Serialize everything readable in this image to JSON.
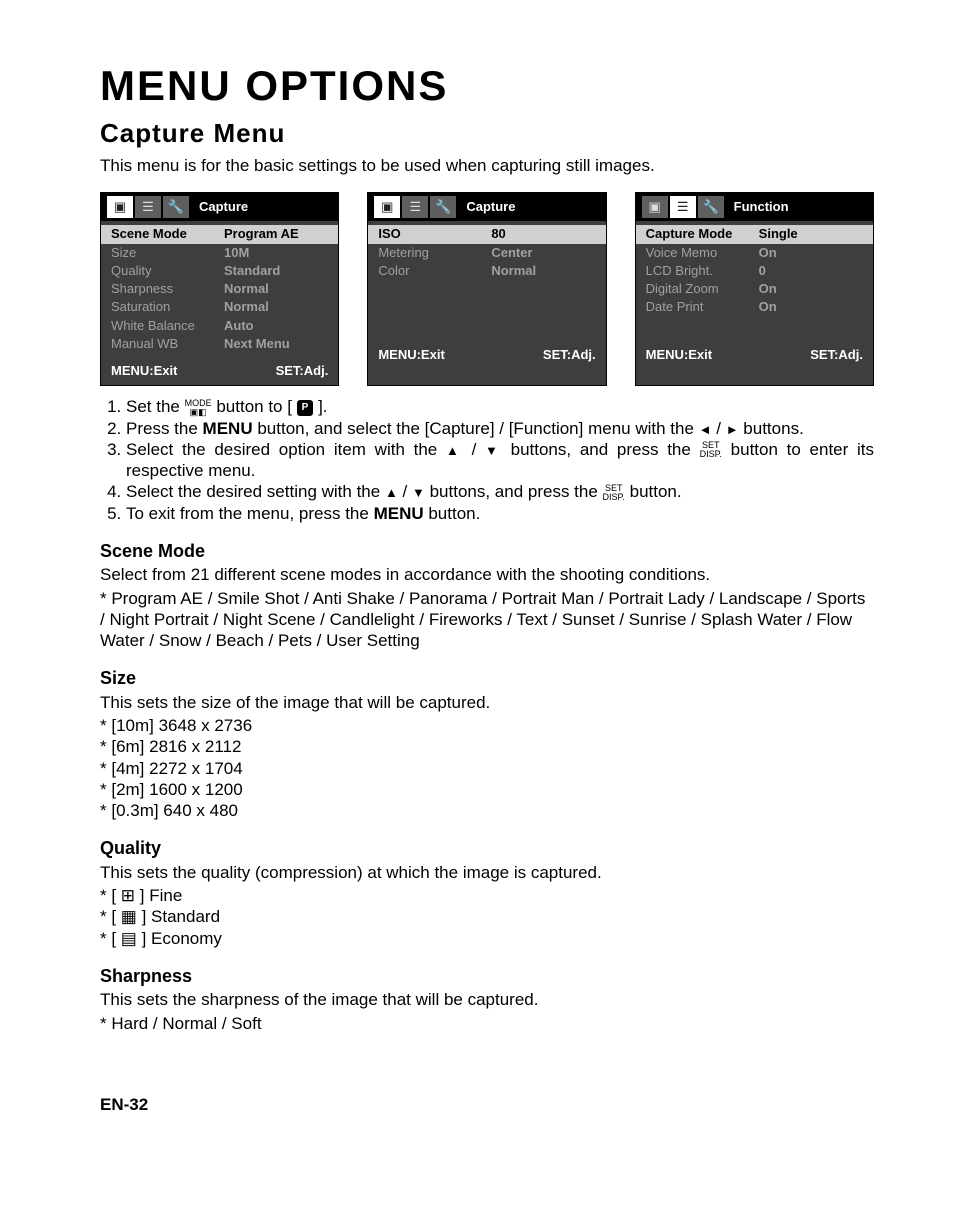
{
  "title": "MENU OPTIONS",
  "subtitle": "Capture Menu",
  "intro": "This menu is for the basic settings to be used when capturing still images.",
  "screens": [
    {
      "activeTab": 0,
      "title": "Capture",
      "rows": [
        {
          "label": "Scene Mode",
          "value": "Program AE",
          "selected": true
        },
        {
          "label": "Size",
          "value": "10M"
        },
        {
          "label": "Quality",
          "value": "Standard"
        },
        {
          "label": "Sharpness",
          "value": "Normal"
        },
        {
          "label": "Saturation",
          "value": "Normal"
        },
        {
          "label": "White Balance",
          "value": "Auto"
        },
        {
          "label": "Manual WB",
          "value": "Next Menu"
        }
      ],
      "footer": {
        "left": "MENU:Exit",
        "right": "SET:Adj."
      }
    },
    {
      "activeTab": 0,
      "title": "Capture",
      "rows": [
        {
          "label": "ISO",
          "value": "80",
          "selected": true
        },
        {
          "label": "Metering",
          "value": "Center"
        },
        {
          "label": "Color",
          "value": "Normal"
        }
      ],
      "footer": {
        "left": "MENU:Exit",
        "right": "SET:Adj."
      }
    },
    {
      "activeTab": 1,
      "title": "Function",
      "rows": [
        {
          "label": "Capture Mode",
          "value": "Single",
          "selected": true
        },
        {
          "label": "Voice Memo",
          "value": "On"
        },
        {
          "label": "LCD Bright.",
          "value": "0"
        },
        {
          "label": "Digital Zoom",
          "value": "On"
        },
        {
          "label": "Date Print",
          "value": "On"
        }
      ],
      "footer": {
        "left": "MENU:Exit",
        "right": "SET:Adj."
      }
    }
  ],
  "steps": [
    "Set the  MODE  button to [ P ].",
    "Press the MENU button, and select the [Capture] / [Function] menu with the ◄ / ► buttons.",
    "Select the desired option item with the ▲ / ▼ buttons, and press the SET/DISP. button to enter its respective menu.",
    "Select the desired setting with the ▲ / ▼ buttons, and press the SET/DISP. button.",
    "To exit from the menu, press the MENU button."
  ],
  "sections": [
    {
      "heading": "Scene Mode",
      "desc": "Select from 21 different scene modes in accordance with the shooting conditions.",
      "options": "* Program AE / Smile Shot / Anti Shake / Panorama / Portrait Man / Portrait Lady / Landscape / Sports / Night Portrait /  Night Scene / Candlelight / Fireworks / Text / Sunset / Sunrise / Splash Water / Flow Water / Snow / Beach / Pets / User Setting"
    },
    {
      "heading": "Size",
      "desc": "This sets the size of the image that will be captured.",
      "bullets": [
        "[10m] 3648 x 2736",
        "[6m] 2816 x 2112",
        "[4m] 2272 x 1704",
        "[2m] 1600 x 1200",
        "[0.3m] 640 x 480"
      ]
    },
    {
      "heading": "Quality",
      "desc": "This sets the quality (compression) at which the image is captured.",
      "bullets": [
        "[ ⊞ ] Fine",
        "[ ▦ ] Standard",
        "[ ▤ ] Economy"
      ]
    },
    {
      "heading": "Sharpness",
      "desc": "This sets the sharpness of the image that will be captured.",
      "options": "* Hard / Normal / Soft"
    }
  ],
  "pageNumber": "EN-32"
}
